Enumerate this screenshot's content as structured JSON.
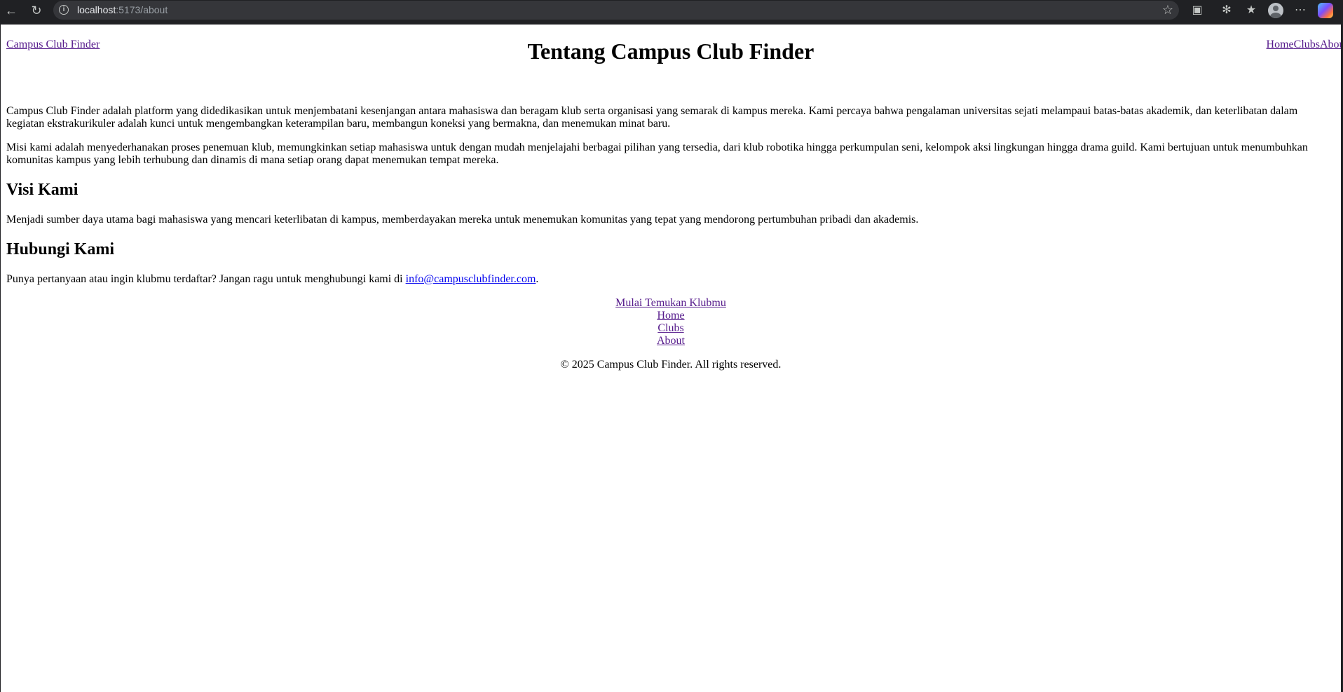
{
  "browser": {
    "url_host": "localhost",
    "url_path": ":5173/about",
    "icons": [
      "back-icon",
      "reload-icon",
      "info-icon",
      "star-icon",
      "extensions-icon",
      "performance-icon",
      "favorites-icon",
      "profile-icon",
      "more-icon",
      "copilot-icon"
    ]
  },
  "header": {
    "brand": "Campus Club Finder",
    "title": "Tentang Campus Club Finder",
    "nav": [
      "Home",
      "Clubs",
      "About"
    ]
  },
  "content": {
    "intro_1": "Campus Club Finder adalah platform yang didedikasikan untuk menjembatani kesenjangan antara mahasiswa dan beragam klub serta organisasi yang semarak di kampus mereka. Kami percaya bahwa pengalaman universitas sejati melampaui batas-batas akademik, dan keterlibatan dalam kegiatan ekstrakurikuler adalah kunci untuk mengembangkan keterampilan baru, membangun koneksi yang bermakna, dan menemukan minat baru.",
    "intro_2": "Misi kami adalah menyederhanakan proses penemuan klub, memungkinkan setiap mahasiswa untuk dengan mudah menjelajahi berbagai pilihan yang tersedia, dari klub robotika hingga perkumpulan seni, kelompok aksi lingkungan hingga drama guild. Kami bertujuan untuk menumbuhkan komunitas kampus yang lebih terhubung dan dinamis di mana setiap orang dapat menemukan tempat mereka.",
    "vision_heading": "Visi Kami",
    "vision_text": "Menjadi sumber daya utama bagi mahasiswa yang mencari keterlibatan di kampus, memberdayakan mereka untuk menemukan komunitas yang tepat yang mendorong pertumbuhan pribadi dan akademis.",
    "contact_heading": "Hubungi Kami",
    "contact_text": "Punya pertanyaan atau ingin klubmu terdaftar? Jangan ragu untuk menghubungi kami di ",
    "contact_email": "info@campusclubfinder.com",
    "contact_end": "."
  },
  "footer": {
    "cta": "Mulai Temukan Klubmu",
    "links": [
      "Home",
      "Clubs",
      "About"
    ],
    "copyright": "© 2025 Campus Club Finder. All rights reserved."
  }
}
